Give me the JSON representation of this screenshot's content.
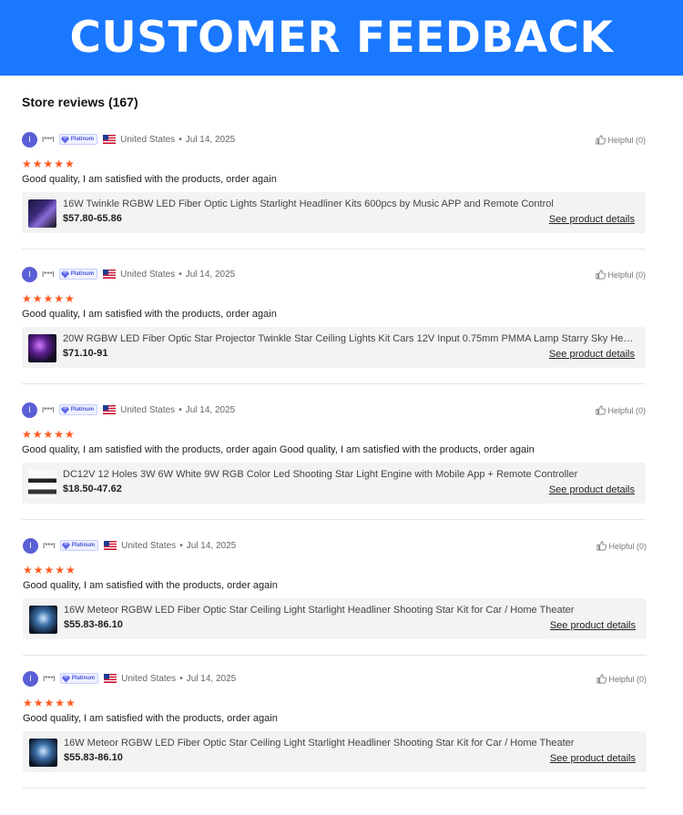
{
  "banner": {
    "title": "CUSTOMER FEEDBACK"
  },
  "section": {
    "title": "Store reviews (167)"
  },
  "colors": {
    "banner": "#1a78ff",
    "stars": "#ff5a1f",
    "avatar": "#5a5fd6",
    "badge": "#4b58d8"
  },
  "reviews": [
    {
      "avatar_letter": "I",
      "reviewer": "I***I",
      "badge": "Platinum",
      "flag_icon": "us-flag-icon",
      "country": "United States",
      "separator": "•",
      "date": "Jul 14, 2025",
      "helpful": "Helpful (0)",
      "stars": "★★★★★",
      "rating": 5,
      "comment": "Good quality, I am satisfied with the products, order again",
      "product": {
        "name": "16W Twinkle RGBW LED Fiber Optic Lights Starlight Headliner Kits 600pcs by Music APP and Remote Control",
        "price": "$57.80-65.86",
        "link": "See product details"
      }
    },
    {
      "avatar_letter": "I",
      "reviewer": "I***I",
      "badge": "Platinum",
      "flag_icon": "us-flag-icon",
      "country": "United States",
      "separator": "•",
      "date": "Jul 14, 2025",
      "helpful": "Helpful (0)",
      "stars": "★★★★★",
      "rating": 5,
      "comment": "Good quality, I am satisfied with the products, order again",
      "product": {
        "name": "20W RGBW LED Fiber Optic Star Projector Twinkle Star Ceiling Lights Kit Cars 12V Input 0.75mm PMMA Lamp Starry Sky Hea...",
        "price": "$71.10-91",
        "link": "See product details"
      }
    },
    {
      "avatar_letter": "I",
      "reviewer": "I***I",
      "badge": "Platinum",
      "flag_icon": "us-flag-icon",
      "country": "United States",
      "separator": "•",
      "date": "Jul 14, 2025",
      "helpful": "Helpful (0)",
      "stars": "★★★★★",
      "rating": 5,
      "comment": "Good quality, I am satisfied with the products, order again Good quality, I am satisfied with the products, order again",
      "product": {
        "name": "DC12V 12 Holes 3W 6W White 9W RGB Color Led Shooting Star Light Engine with Mobile App + Remote Controller",
        "price": "$18.50-47.62",
        "link": "See product details"
      }
    },
    {
      "avatar_letter": "I",
      "reviewer": "I***I",
      "badge": "Platinum",
      "flag_icon": "us-flag-icon",
      "country": "United States",
      "separator": "•",
      "date": "Jul 14, 2025",
      "helpful": "Helpful (0)",
      "stars": "★★★★★",
      "rating": 5,
      "comment": "Good quality, I am satisfied with the products, order again",
      "product": {
        "name": "16W Meteor RGBW LED Fiber Optic Star Ceiling Light Starlight Headliner Shooting Star Kit for Car / Home Theater",
        "price": "$55.83-86.10",
        "link": "See product details"
      }
    },
    {
      "avatar_letter": "I",
      "reviewer": "I***I",
      "badge": "Platinum",
      "flag_icon": "us-flag-icon",
      "country": "United States",
      "separator": "•",
      "date": "Jul 14, 2025",
      "helpful": "Helpful (0)",
      "stars": "★★★★★",
      "rating": 5,
      "comment": "Good quality, I am satisfied with the products, order again",
      "product": {
        "name": "16W Meteor RGBW LED Fiber Optic Star Ceiling Light Starlight Headliner Shooting Star Kit for Car / Home Theater",
        "price": "$55.83-86.10",
        "link": "See product details"
      }
    }
  ]
}
